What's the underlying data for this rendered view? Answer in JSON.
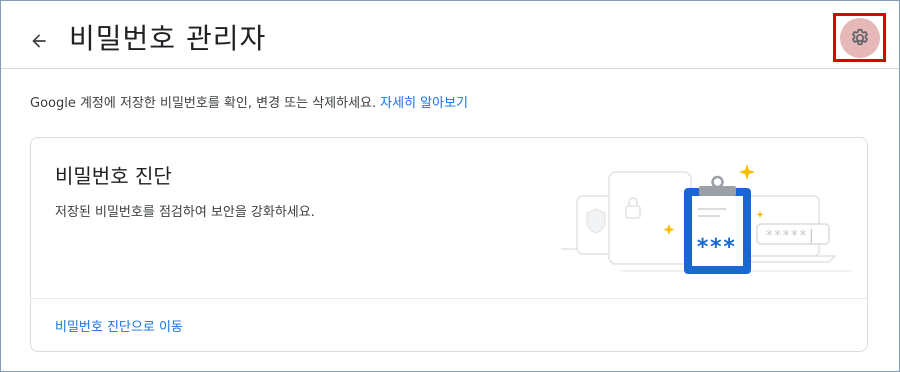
{
  "header": {
    "title": "비밀번호 관리자",
    "back_icon": "arrow-back-icon",
    "settings_icon": "gear-icon"
  },
  "description": {
    "text": "Google 계정에 저장한 비밀번호를 확인, 변경 또는 삭제하세요.",
    "link": "자세히 알아보기"
  },
  "checkup_card": {
    "title": "비밀번호 진단",
    "subtitle": "저장된 비밀번호를 점검하여 보안을 강화하세요.",
    "action_link": "비밀번호 진단으로 이동",
    "illustration_icon": "clipboard-password-icon",
    "masked_password": "***",
    "masked_field": "*****|"
  },
  "colors": {
    "accent": "#1a73e8",
    "highlight_border": "#e00000",
    "clipboard_blue": "#1967d2",
    "sparkle": "#fbbc04"
  }
}
